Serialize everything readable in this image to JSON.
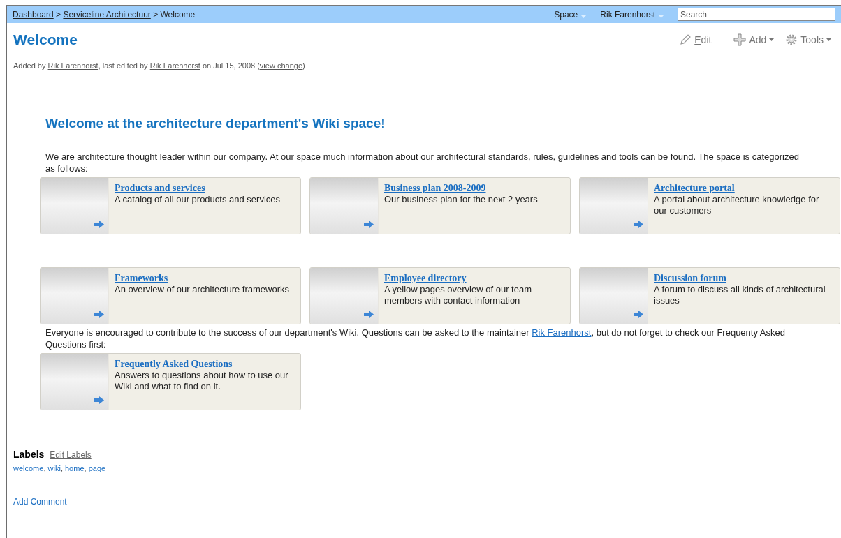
{
  "breadcrumb": [
    {
      "text": "Dashboard",
      "kind": "link"
    },
    {
      "text": " > ",
      "kind": "text"
    },
    {
      "text": "Serviceline Architectuur",
      "kind": "link"
    },
    {
      "text": " > Welcome",
      "kind": "text"
    }
  ],
  "top_menu": [
    {
      "label": "Space"
    },
    {
      "label": "Rik Farenhorst"
    }
  ],
  "search": {
    "placeholder": "Search"
  },
  "title": "Welcome",
  "actions": [
    {
      "label": "Edit",
      "kind": "edit",
      "dropdown": false
    },
    {
      "label": "Add",
      "kind": "add",
      "dropdown": true
    },
    {
      "label": "Tools",
      "kind": "tools",
      "dropdown": true
    }
  ],
  "byline": [
    {
      "text": "Added by ",
      "kind": "text"
    },
    {
      "text": "Rik Farenhorst",
      "kind": "link"
    },
    {
      "text": ", last edited by ",
      "kind": "text"
    },
    {
      "text": "Rik Farenhorst",
      "kind": "link"
    },
    {
      "text": " on Jul 15, 2008  (",
      "kind": "text"
    },
    {
      "text": "view change",
      "kind": "link"
    },
    {
      "text": ")",
      "kind": "text"
    }
  ],
  "heading": "Welcome at the architecture department's Wiki space!",
  "intro": "We are architecture thought leader within our company. At our space much information about our architectural standards, rules, guidelines and tools can be found. The space is categorized as follows:",
  "cards": [
    {
      "title": "Products and services",
      "text": "A catalog of all our products and services"
    },
    {
      "title": "Business plan 2008-2009",
      "text": "Our business plan for the next 2 years"
    },
    {
      "title": "Architecture portal",
      "text": "A portal about architecture knowledge for our customers"
    },
    {
      "title": "Frameworks",
      "text": "An overview of our architecture frameworks"
    },
    {
      "title": "Employee directory",
      "text": "A yellow pages overview of our team members with contact information"
    },
    {
      "title": "Discussion forum",
      "text": "A forum to discuss all kinds of architectural issues"
    }
  ],
  "contribute": [
    {
      "text": "Everyone is encouraged to contribute to the success of our department's Wiki. Questions can be asked to the maintainer ",
      "kind": "text"
    },
    {
      "text": "Rik Farenhorst",
      "kind": "link"
    },
    {
      "text": ", but do not forget to check our Frequenty Asked Questions first:",
      "kind": "text"
    }
  ],
  "faq_card": {
    "title": "Frequently Asked Questions",
    "text": "Answers to questions about how to use our Wiki and what to find on it."
  },
  "labels": {
    "heading": "Labels",
    "edit": "Edit Labels",
    "separator": ",",
    "items": [
      "welcome",
      "wiki",
      "home",
      "page"
    ]
  },
  "add_comment": "Add Comment"
}
